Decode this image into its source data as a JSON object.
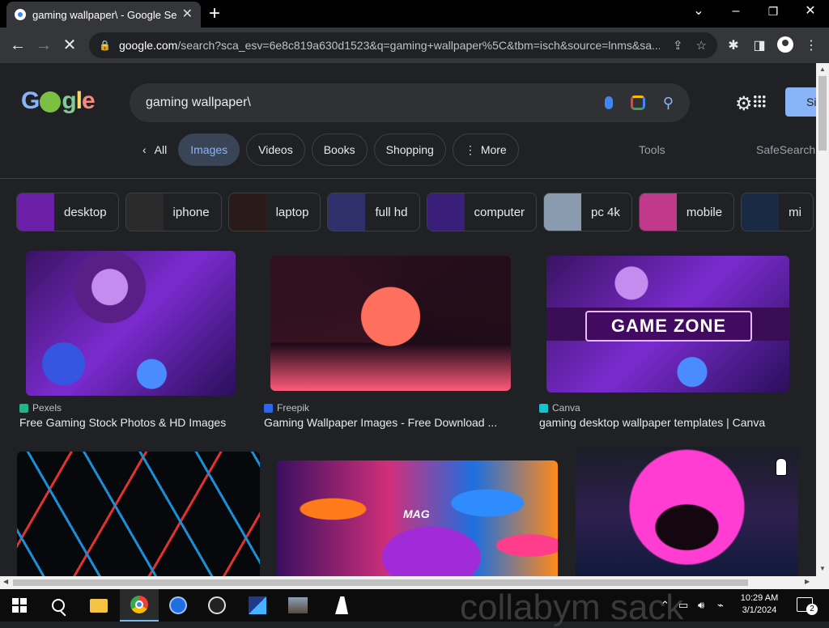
{
  "tab": {
    "title": "gaming wallpaper\\ - Google Search",
    "close": "✕"
  },
  "window": {
    "new_tab": "+",
    "chevron": "⌄",
    "minimize": "–",
    "restore": "❐",
    "close": "✕"
  },
  "toolbar": {
    "url_host": "google.com",
    "url_path": "/search?sca_esv=6e8c819a630d1523&q=gaming+wallpaper%5C&tbm=isch&source=lnms&sa..."
  },
  "search": {
    "query": "gaming wallpaper\\",
    "signin": "Si"
  },
  "nav_tabs": [
    {
      "label": "All"
    },
    {
      "label": "Images"
    },
    {
      "label": "Videos"
    },
    {
      "label": "Books"
    },
    {
      "label": "Shopping"
    },
    {
      "label": "More"
    }
  ],
  "tools": "Tools",
  "safesearch": "SafeSearch",
  "filters": [
    {
      "label": "desktop",
      "color": "#6b1fa8"
    },
    {
      "label": "iphone",
      "color": "#2a2a2a"
    },
    {
      "label": "laptop",
      "color": "#2b1a1a"
    },
    {
      "label": "full hd",
      "color": "#2f2f6b"
    },
    {
      "label": "computer",
      "color": "#3a1f7a"
    },
    {
      "label": "pc 4k",
      "color": "#8a9bb0"
    },
    {
      "label": "mobile",
      "color": "#c0398a"
    },
    {
      "label": "mi",
      "color": "#1b2a44"
    }
  ],
  "results": [
    {
      "source": "Pexels",
      "caption": "Free Gaming Stock Photos & HD Images",
      "fav_color": "#1fb48a"
    },
    {
      "source": "Freepik",
      "caption": "Gaming Wallpaper Images - Free Download ...",
      "fav_color": "#2a66f0"
    },
    {
      "source": "Canva",
      "caption": "gaming desktop wallpaper templates | Canva",
      "fav_color": "#12c4cc",
      "overlay": "GAME ZONE"
    },
    {
      "overlay": "MAG"
    }
  ],
  "taskbar": {
    "watermark": "collabym sack",
    "time": "10:29 AM",
    "date": "3/1/2024",
    "notifications": "2"
  }
}
